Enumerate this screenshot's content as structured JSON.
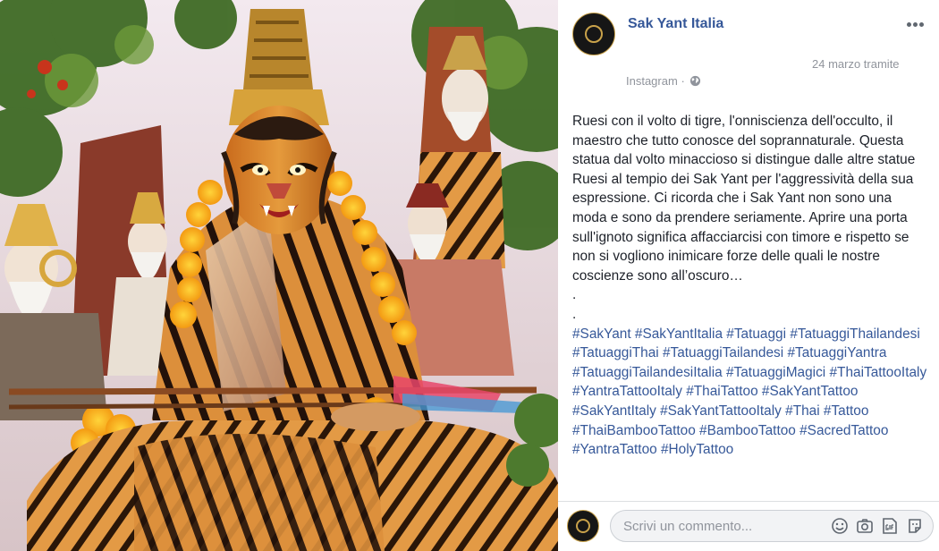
{
  "post": {
    "page_name": "Sak Yant Italia",
    "date": "24 marzo tramite",
    "source": "Instagram",
    "separator": "·",
    "body": "Ruesi con il volto di tigre, l'onniscienza dell'occulto, il maestro che tutto conosce del soprannaturale. Questa statua dal volto minaccioso si distingue dalle altre statue Ruesi al tempio dei Sak Yant per l'aggressività della sua espressione. Ci ricorda che i Sak Yant non sono una moda e sono da prendere seriamente. Aprire una porta sull'ignoto significa affacciarcisi con timore e rispetto se non si vogliono inimicare forze delle quali le nostre coscienze sono all’oscuro…",
    "dots": [
      ".",
      "."
    ],
    "hashtags": [
      "#SakYant",
      "#SakYantItalia",
      "#Tatuaggi",
      "#TatuaggiThailandesi",
      "#TatuaggiThai",
      "#TatuaggiTailandesi",
      "#TatuaggiYantra",
      "#TatuaggiTailandesiItalia",
      "#TatuaggiMagici",
      "#ThaiTattooItaly",
      "#YantraTattooItaly",
      "#ThaiTattoo",
      "#SakYantTattoo",
      "#SakYantItaly",
      "#SakYantTattooItaly",
      "#Thai",
      "#Tattoo",
      "#ThaiBambooTattoo",
      "#BambooTattoo",
      "#SacredTattoo",
      "#YantraTattoo",
      "#HolyTattoo"
    ]
  },
  "comment": {
    "placeholder": "Scrivi un commento..."
  },
  "icons": {
    "more": "more-options-icon",
    "privacy": "globe-icon",
    "emoji": "emoji-icon",
    "camera": "camera-icon",
    "gif": "gif-icon",
    "sticker": "sticker-icon"
  },
  "colors": {
    "link": "#365899",
    "meta": "#90949c",
    "text": "#1d2129"
  }
}
